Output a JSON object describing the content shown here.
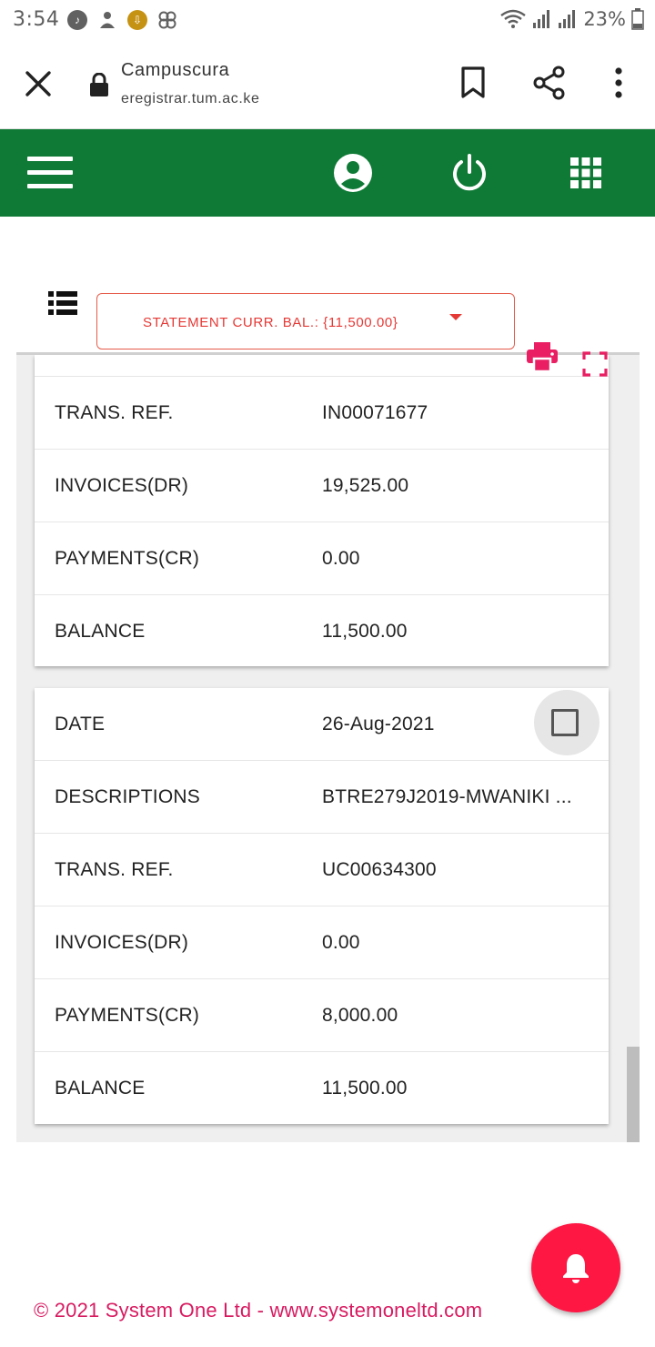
{
  "status_bar": {
    "time": "3:54",
    "battery": "23%"
  },
  "browser": {
    "title": "Campuscura",
    "url": "eregistrar.tum.ac.ke"
  },
  "statement_select": {
    "label": "STATEMENT CURR. BAL.: {11,500.00}"
  },
  "card1": {
    "rows": [
      {
        "key": "TRANS. REF.",
        "value": "IN00071677"
      },
      {
        "key": "INVOICES(DR)",
        "value": "19,525.00"
      },
      {
        "key": "PAYMENTS(CR)",
        "value": "0.00"
      },
      {
        "key": "BALANCE",
        "value": "11,500.00"
      }
    ]
  },
  "card2": {
    "rows": [
      {
        "key": "DATE",
        "value": "26-Aug-2021"
      },
      {
        "key": "DESCRIPTIONS",
        "value": "BTRE279J2019-MWANIKI ..."
      },
      {
        "key": "TRANS. REF.",
        "value": "UC00634300"
      },
      {
        "key": "INVOICES(DR)",
        "value": "0.00"
      },
      {
        "key": "PAYMENTS(CR)",
        "value": "8,000.00"
      },
      {
        "key": "BALANCE",
        "value": "11,500.00"
      }
    ]
  },
  "footer": {
    "text": "© 2021 System One Ltd - www.systemoneltd.com"
  },
  "colors": {
    "header_green": "#0f7a36",
    "accent_red": "#e53935",
    "fab_red": "#ff1744",
    "footer_pink": "#d81b60"
  },
  "icons": {
    "header": [
      "menu-icon",
      "account-icon",
      "power-icon",
      "apps-grid-icon"
    ],
    "toolbar": [
      "list-icon",
      "print-icon",
      "fullscreen-icon"
    ],
    "fab": "bell-icon"
  }
}
